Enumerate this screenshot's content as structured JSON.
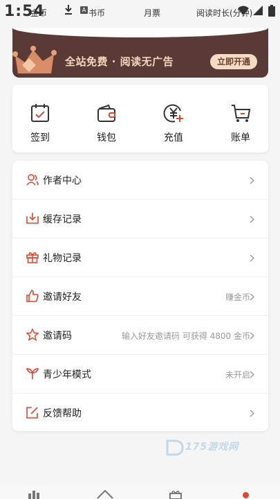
{
  "status": {
    "time": "1:54",
    "stats": [
      "金币",
      "书币",
      "月票",
      "阅读时长(分钟)"
    ]
  },
  "banner": {
    "text": "全站免费 · 阅读无广告",
    "button": "立即开通"
  },
  "actions": [
    {
      "label": "签到",
      "icon": "calendar-check-icon"
    },
    {
      "label": "钱包",
      "icon": "wallet-icon"
    },
    {
      "label": "充值",
      "icon": "yuan-coin-plus-icon"
    },
    {
      "label": "账单",
      "icon": "cart-icon"
    }
  ],
  "menu": [
    {
      "label": "作者中心",
      "hint": "",
      "icon": "author-icon"
    },
    {
      "label": "缓存记录",
      "hint": "",
      "icon": "download-box-icon"
    },
    {
      "label": "礼物记录",
      "hint": "",
      "icon": "gift-icon"
    },
    {
      "label": "邀请好友",
      "hint": "赚金币",
      "icon": "thumbs-up-icon"
    },
    {
      "label": "邀请码",
      "hint": "输入好友邀请码 可获得 4800 金币",
      "icon": "star-icon"
    },
    {
      "label": "青少年模式",
      "hint": "未开启",
      "icon": "sprout-icon"
    },
    {
      "label": "反馈帮助",
      "hint": "",
      "icon": "edit-icon"
    }
  ],
  "watermark": {
    "text": "175游戏网"
  },
  "colors": {
    "accent": "#e8432f",
    "banner_bg": "#5a3a36",
    "banner_text": "#f3d6bb"
  }
}
